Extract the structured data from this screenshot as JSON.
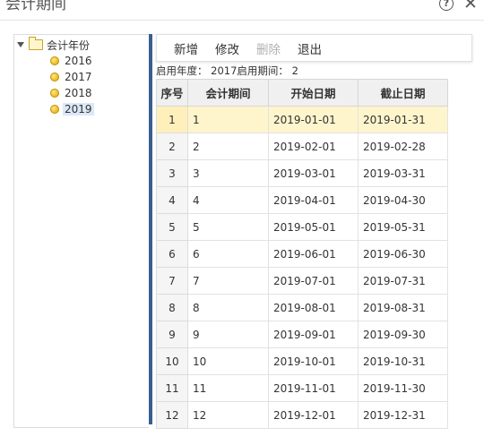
{
  "window": {
    "title": "会计期间",
    "help_glyph": "?",
    "close_glyph": "✕"
  },
  "tree": {
    "root_label": "会计年份",
    "years": [
      "2016",
      "2017",
      "2018",
      "2019"
    ],
    "selected_year": "2019"
  },
  "toolbar": {
    "add": "新增",
    "edit": "修改",
    "delete": "删除",
    "exit": "退出"
  },
  "info_line": "启用年度： 2017启用期间： 2",
  "table": {
    "columns": [
      "序号",
      "会计期间",
      "开始日期",
      "截止日期"
    ],
    "selected_row": 1,
    "rows": [
      {
        "index": "1",
        "period": "1",
        "start": "2019-01-01",
        "end": "2019-01-31"
      },
      {
        "index": "2",
        "period": "2",
        "start": "2019-02-01",
        "end": "2019-02-28"
      },
      {
        "index": "3",
        "period": "3",
        "start": "2019-03-01",
        "end": "2019-03-31"
      },
      {
        "index": "4",
        "period": "4",
        "start": "2019-04-01",
        "end": "2019-04-30"
      },
      {
        "index": "5",
        "period": "5",
        "start": "2019-05-01",
        "end": "2019-05-31"
      },
      {
        "index": "6",
        "period": "6",
        "start": "2019-06-01",
        "end": "2019-06-30"
      },
      {
        "index": "7",
        "period": "7",
        "start": "2019-07-01",
        "end": "2019-07-31"
      },
      {
        "index": "8",
        "period": "8",
        "start": "2019-08-01",
        "end": "2019-08-31"
      },
      {
        "index": "9",
        "period": "9",
        "start": "2019-09-01",
        "end": "2019-09-30"
      },
      {
        "index": "10",
        "period": "10",
        "start": "2019-10-01",
        "end": "2019-10-31"
      },
      {
        "index": "11",
        "period": "11",
        "start": "2019-11-01",
        "end": "2019-11-30"
      },
      {
        "index": "12",
        "period": "12",
        "start": "2019-12-01",
        "end": "2019-12-31"
      }
    ]
  }
}
